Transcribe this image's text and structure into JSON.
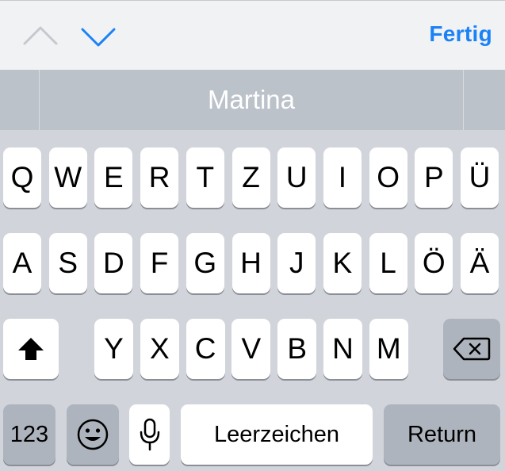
{
  "toolbar": {
    "prev_icon": "chevron-up-icon",
    "next_icon": "chevron-down-icon",
    "done_label": "Fertig",
    "accent_color": "#1a82f6"
  },
  "suggestions": [
    "",
    "Martina",
    ""
  ],
  "keyboard": {
    "row1": [
      "Q",
      "W",
      "E",
      "R",
      "T",
      "Z",
      "U",
      "I",
      "O",
      "P",
      "Ü"
    ],
    "row2": [
      "A",
      "S",
      "D",
      "F",
      "G",
      "H",
      "J",
      "K",
      "L",
      "Ö",
      "Ä"
    ],
    "row3": [
      "Y",
      "X",
      "C",
      "V",
      "B",
      "N",
      "M"
    ],
    "shift_icon": "shift-icon",
    "delete_icon": "backspace-icon",
    "numbers_label": "123",
    "emoji_icon": "emoji-icon",
    "mic_icon": "microphone-icon",
    "space_label": "Leerzeichen",
    "return_label": "Return"
  }
}
